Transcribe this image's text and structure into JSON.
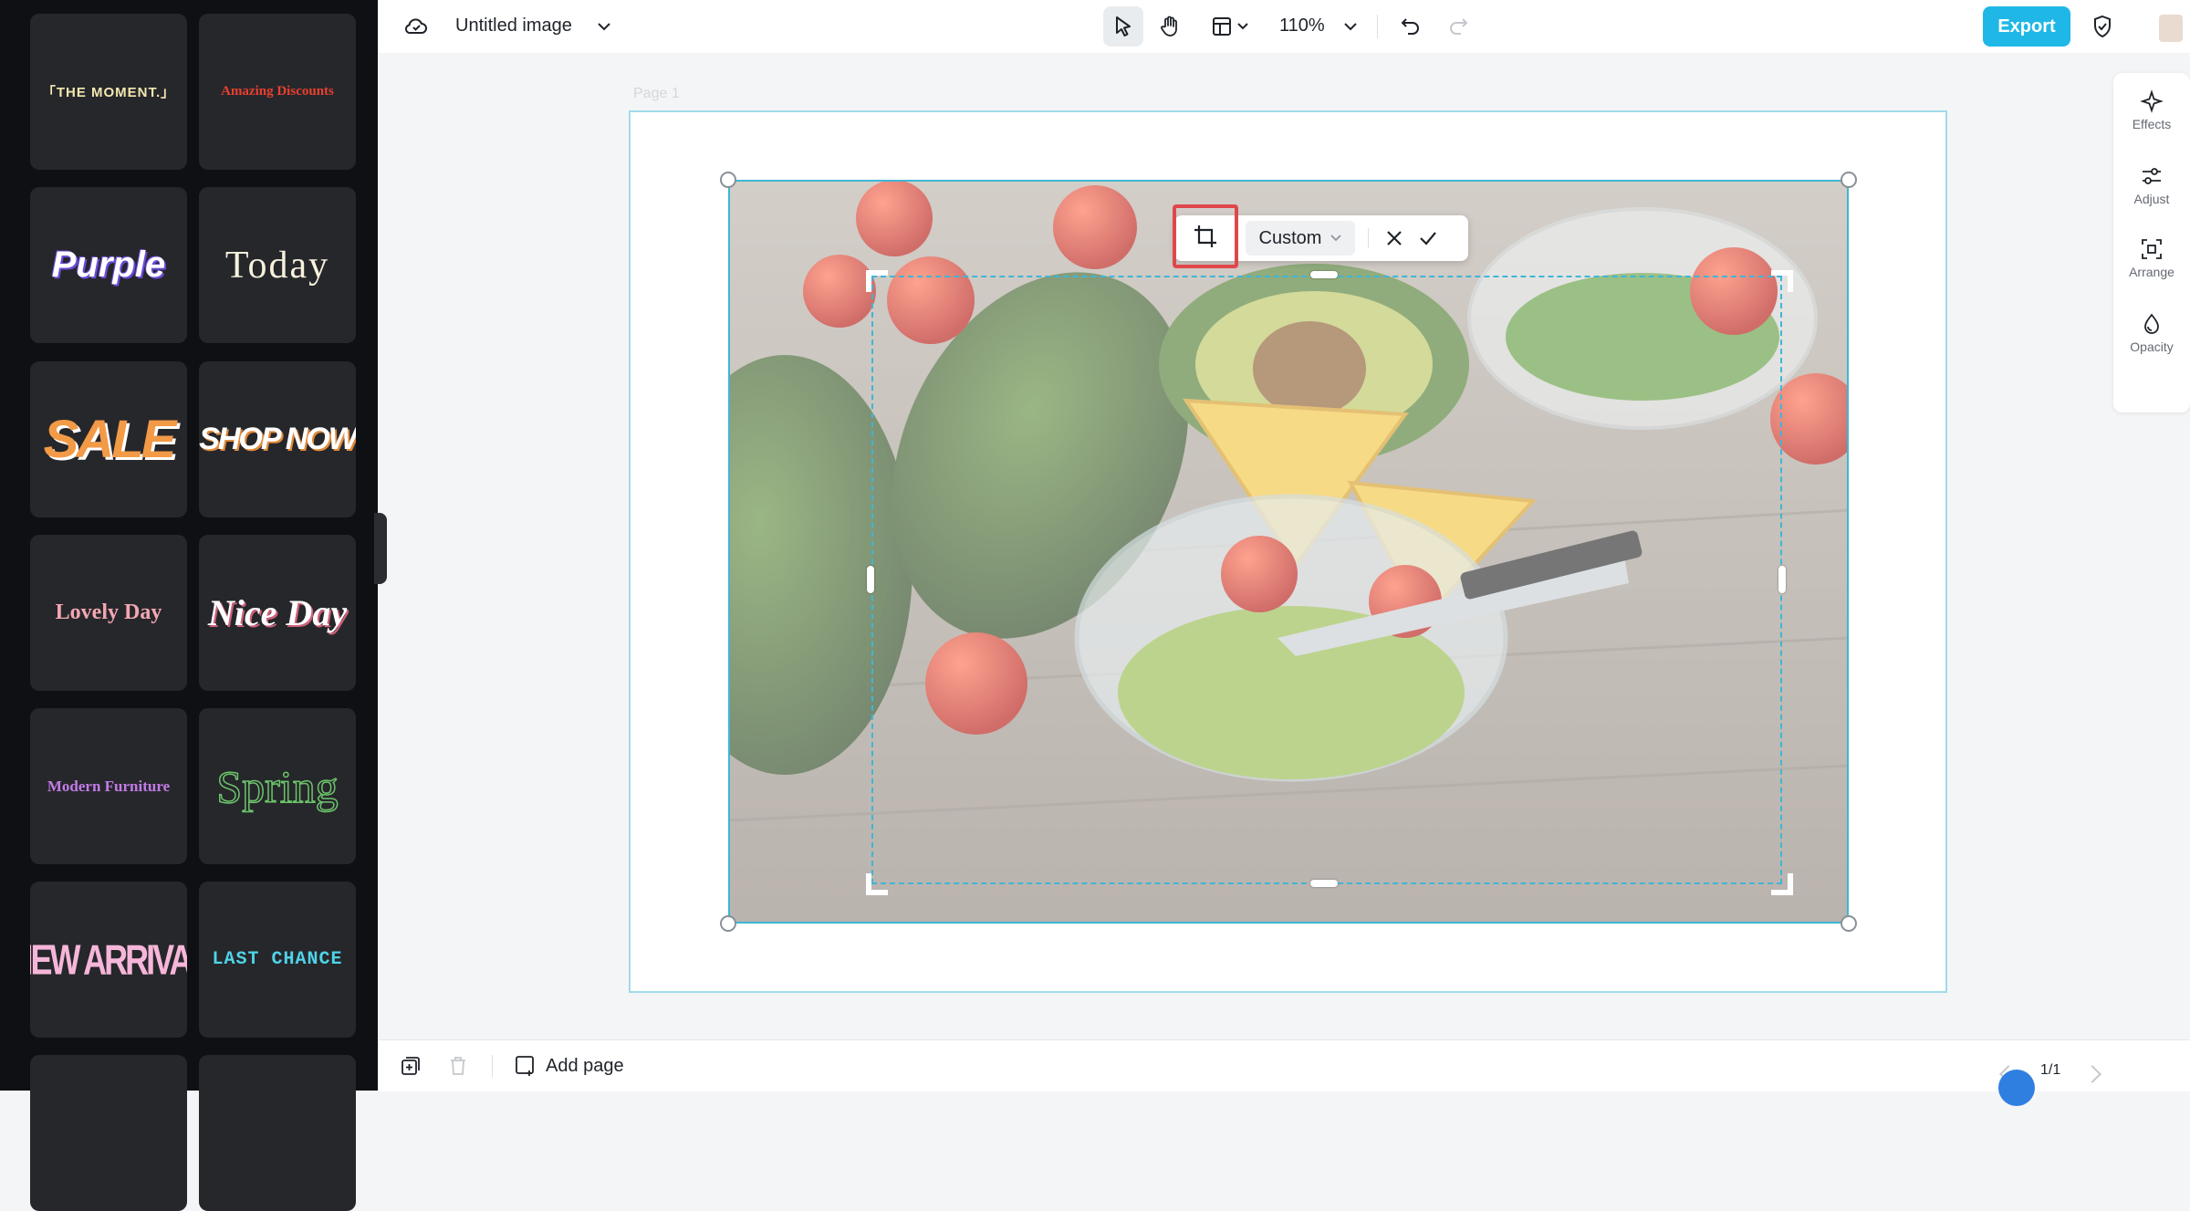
{
  "document": {
    "title": "Untitled image",
    "page_label": "Page 1"
  },
  "toolbar": {
    "zoom": "110%",
    "export_label": "Export"
  },
  "crop_toolbar": {
    "ratio_label": "Custom"
  },
  "right_rail": [
    {
      "label": "Effects"
    },
    {
      "label": "Adjust"
    },
    {
      "label": "Arrange"
    },
    {
      "label": "Opacity"
    }
  ],
  "bottom": {
    "add_page_label": "Add page",
    "page_counter": "1/1"
  },
  "templates": [
    {
      "text": "「THE MOMENT.」"
    },
    {
      "text": "Amazing Discounts"
    },
    {
      "text": "Purple"
    },
    {
      "text": "Today"
    },
    {
      "text": "SALE"
    },
    {
      "text": "SHOP NOW"
    },
    {
      "text": "Lovely Day"
    },
    {
      "text": "Nice Day"
    },
    {
      "text": "Modern Furniture"
    },
    {
      "text": "Spring"
    },
    {
      "text": "NEW ARRIVAL"
    },
    {
      "text": "LAST CHANCE"
    }
  ],
  "colors": {
    "accent": "#1fb8e6",
    "selection": "#3fb6d6",
    "highlight": "#e0474c"
  }
}
